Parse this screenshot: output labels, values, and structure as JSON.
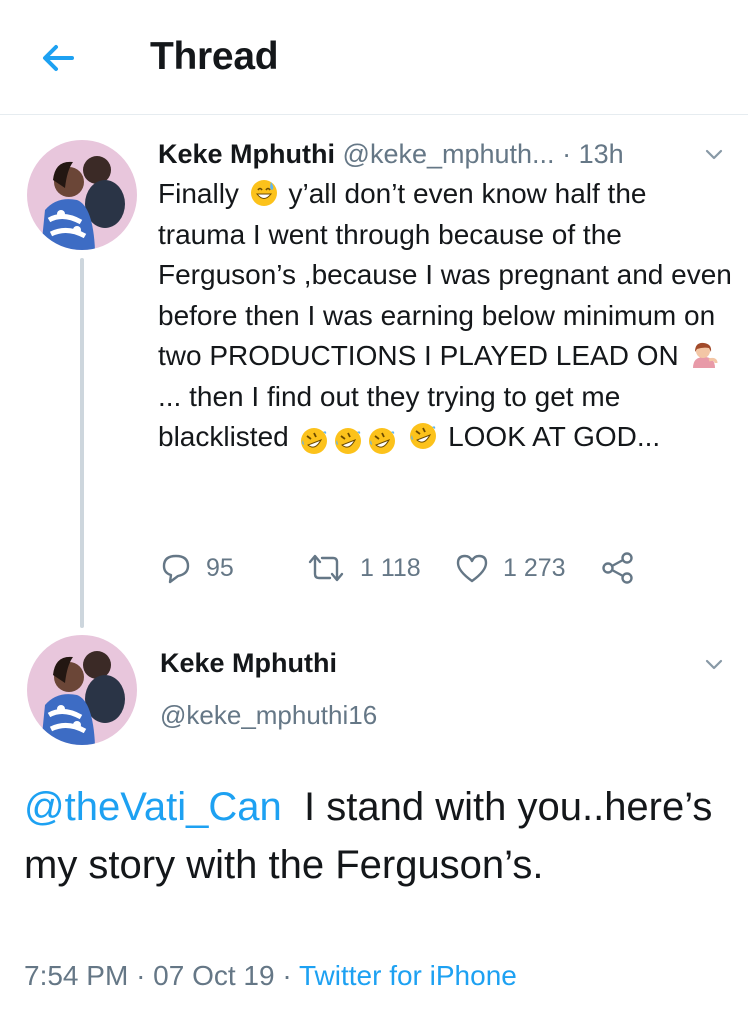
{
  "header": {
    "title": "Thread",
    "back_icon": "back-arrow-icon",
    "accent": "#1da1f2"
  },
  "tweet1": {
    "name": "Keke Mphuthi",
    "handle": "@keke_mphuth...",
    "dot": "·",
    "time": "13h",
    "text_parts": [
      "Finally",
      "y’all don’t even know half the trauma I went through because of the Ferguson’s ,because I was pregnant and even before then I was earning below minimum on two PRODUCTIONS I PLAYED LEAD ON",
      "... then I find out they trying to get me blacklisted",
      "LOOK AT GOD..."
    ],
    "emojis": [
      "grinning-sweat-emoji",
      "woman-tipping-hand-emoji",
      "rofl-emoji"
    ],
    "replies": "95",
    "retweets": "1 118",
    "likes": "1 273"
  },
  "tweet2": {
    "name": "Keke Mphuthi",
    "handle": "@keke_mphuthi16",
    "mention": "@theVati_Can",
    "text": "I stand with you..here’s my story with the Ferguson’s.",
    "time": "7:54 PM",
    "date": "07 Oct 19",
    "dot": "·",
    "source": "Twitter for iPhone"
  },
  "colors": {
    "text": "#14171a",
    "secondary": "#657786",
    "link": "#1da1f2",
    "thread_line": "#cdd6dd"
  }
}
